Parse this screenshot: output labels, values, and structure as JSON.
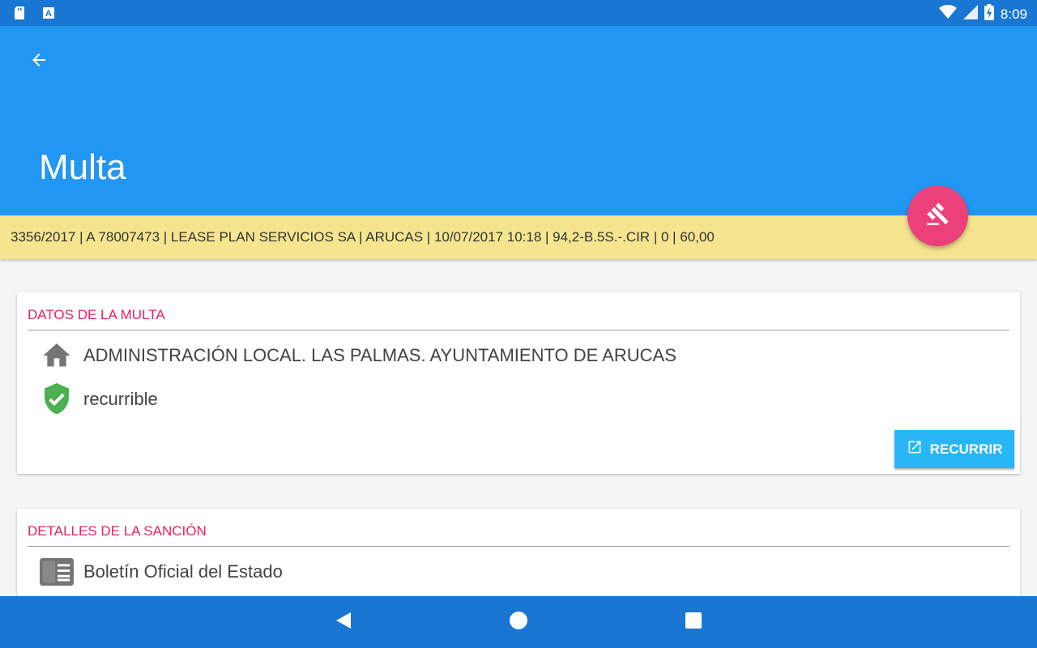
{
  "status_bar": {
    "time": "8:09",
    "left_icons": [
      "sd-card-icon",
      "accessibility-a-icon"
    ],
    "right_icons": [
      "wifi-icon",
      "signal-icon",
      "battery-charging-icon"
    ]
  },
  "app_bar": {
    "back_icon": "arrow-left-icon",
    "title": "Multa",
    "color": "#2196f3"
  },
  "summary": {
    "text": "3356/2017 | A 78007473 | LEASE PLAN SERVICIOS SA | ARUCAS | 10/07/2017 10:18 | 94,2-B.5S.-.CIR | 0 | 60,00",
    "background": "#f5e58f"
  },
  "fab": {
    "icon": "gavel-icon",
    "color": "#ec407a"
  },
  "card_multa": {
    "header": "DATOS DE LA MULTA",
    "authority": {
      "icon": "home-icon",
      "text": "ADMINISTRACIÓN LOCAL. LAS PALMAS. AYUNTAMIENTO DE ARUCAS"
    },
    "status": {
      "icon": "shield-check-icon",
      "text": "recurrible",
      "color": "#4caf50"
    },
    "button": {
      "icon": "open-external-icon",
      "label": "RECURRIR"
    }
  },
  "card_sancion": {
    "header": "DETALLES DE LA SANCIÓN",
    "source": {
      "icon": "newspaper-icon",
      "text": "Boletín Oficial del Estado"
    }
  },
  "nav_bar": {
    "buttons": [
      "back-triangle-icon",
      "home-circle-icon",
      "recents-square-icon"
    ]
  },
  "colors": {
    "accent": "#e91e63",
    "primary_dark": "#1976d2",
    "button": "#29b6f6"
  }
}
